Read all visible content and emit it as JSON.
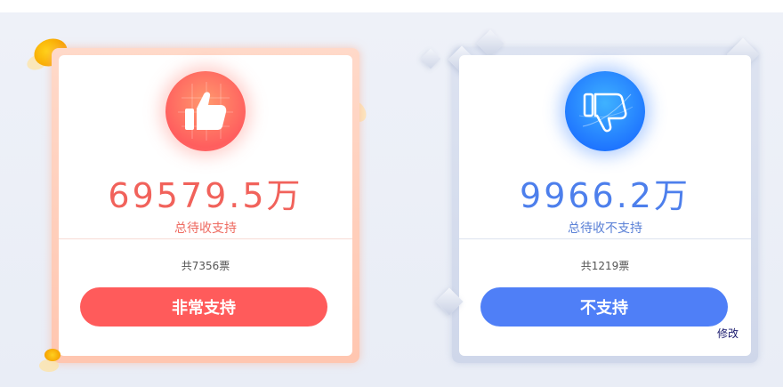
{
  "support": {
    "amount": "69579.5万",
    "label": "总待收支持",
    "votes": "共7356票",
    "button": "非常支持"
  },
  "oppose": {
    "amount": "9966.2万",
    "label": "总待收不支持",
    "votes": "共1219票",
    "button": "不支持"
  },
  "edit_link": "修改",
  "colors": {
    "support_accent": "#ff5b5b",
    "oppose_accent": "#4f7ff7",
    "background": "#eef1f8"
  },
  "icons": {
    "support": "thumbs-up-icon",
    "oppose": "thumbs-down-icon"
  }
}
